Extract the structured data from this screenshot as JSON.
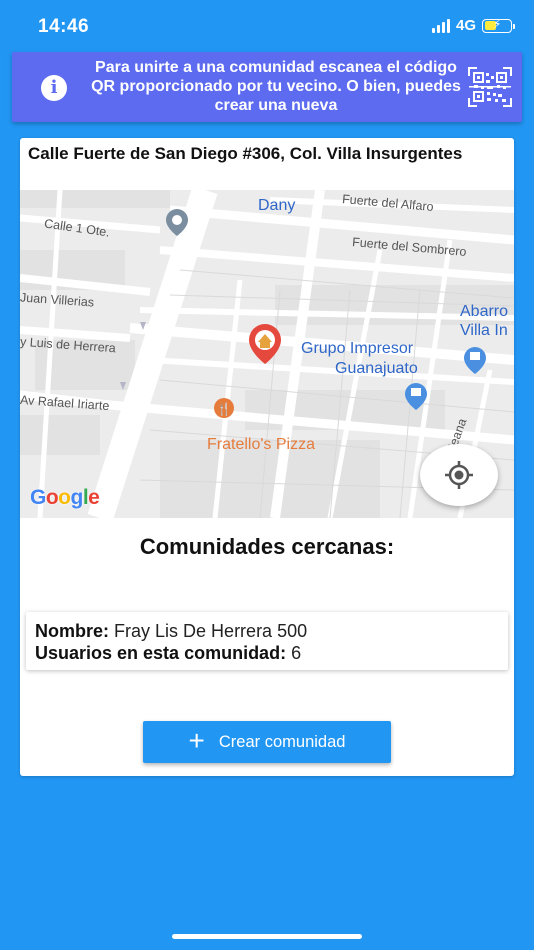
{
  "status_bar": {
    "time": "14:46",
    "network": "4G",
    "icons": [
      "signal-icon",
      "battery-charging-icon"
    ]
  },
  "banner": {
    "text": "Para unirte a una comunidad escanea el código QR proporcionado por tu vecino. O bien, puedes crear una nueva",
    "icons": [
      "info-icon",
      "qr-code-icon"
    ]
  },
  "card": {
    "address": "Calle Fuerte de San Diego #306, Col. Villa Insurgentes"
  },
  "map": {
    "street_labels": {
      "calle_1_ote": "Calle 1 Ote.",
      "juan_villerias": "Juan Villerias",
      "luis_de_herrera": "y Luis de Herrera",
      "rafael_iriarte": "Av Rafael Iriarte",
      "fuerte_del_alfaro": "Fuerte del Alfaro",
      "fuerte_del_sombrero": "Fuerte del Sombrero",
      "street_right": "Jeana"
    },
    "pois": {
      "dany": "Dany",
      "abarrotes": "Abarro",
      "villa": "Villa In",
      "grupo_impresor": "Grupo Impresor",
      "guanajuato": "Guanajuato",
      "fratellos_pizza": "Fratello's Pizza"
    },
    "google_logo": "Google",
    "colors": {
      "background": "#ECECEC",
      "road": "#FFFFFF",
      "block": "#E3E3E3",
      "poi_blue": "#2F67C8",
      "poi_orange": "#E67C3C",
      "marker": "#E5483C"
    }
  },
  "nearby": {
    "title": "Comunidades cercanas:",
    "items": [
      {
        "name_label": "Nombre:",
        "name": "Fray Lis De Herrera 500",
        "users_label": "Usuarios en esta comunidad:",
        "users": "6"
      }
    ]
  },
  "create_button": {
    "label": "Crear comunidad"
  },
  "colors": {
    "background": "#2196F3",
    "banner": "#5C6BF0",
    "card": "#FFFFFF"
  }
}
